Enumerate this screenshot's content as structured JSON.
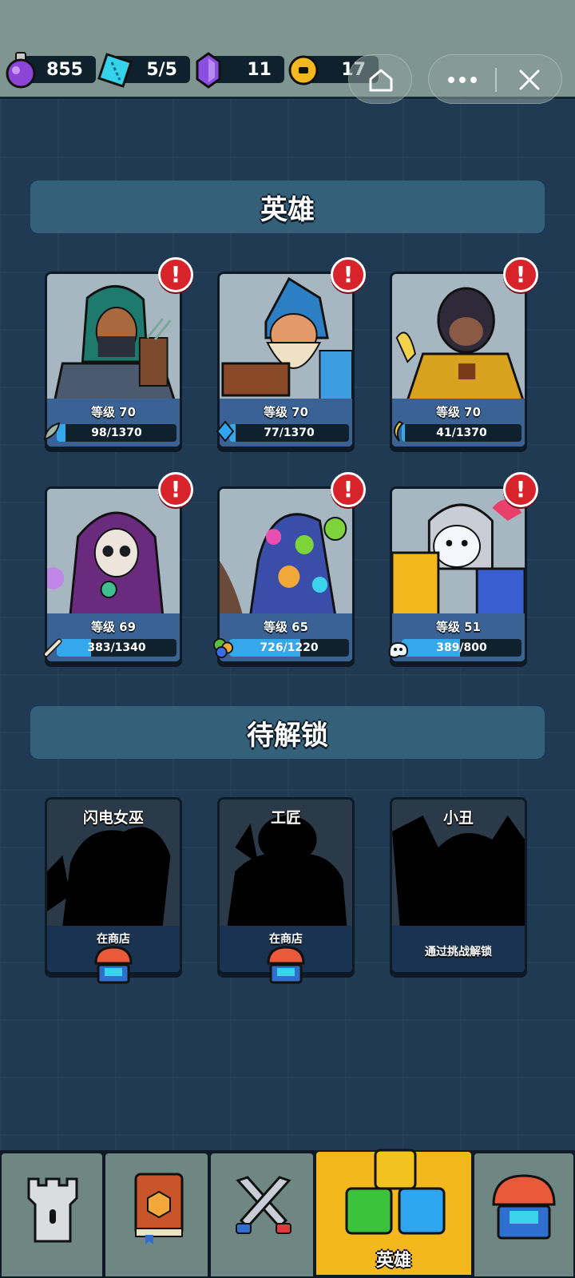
{
  "resources": [
    {
      "name": "potion",
      "value": "855",
      "icon": "potion-icon"
    },
    {
      "name": "ticket",
      "value": "5/5",
      "icon": "ticket-icon"
    },
    {
      "name": "gem",
      "value": "11",
      "icon": "gem-icon"
    },
    {
      "name": "coin",
      "value": "17",
      "icon": "coin-icon"
    }
  ],
  "sections": {
    "heroes_title": "英雄",
    "locked_title": "待解锁"
  },
  "heroes": [
    {
      "level": "等级 70",
      "progress": "98/1370",
      "fill": 0.0715,
      "shard_icon": "feather-shard-icon"
    },
    {
      "level": "等级 70",
      "progress": "77/1370",
      "fill": 0.0562,
      "shard_icon": "crystal-shard-icon"
    },
    {
      "level": "等级 70",
      "progress": "41/1370",
      "fill": 0.0299,
      "shard_icon": "banana-shard-icon"
    },
    {
      "level": "等级 69",
      "progress": "383/1340",
      "fill": 0.2858,
      "shard_icon": "bone-shard-icon"
    },
    {
      "level": "等级 65",
      "progress": "726/1220",
      "fill": 0.5951,
      "shard_icon": "slime-shard-icon"
    },
    {
      "level": "等级 51",
      "progress": "389/800",
      "fill": 0.4863,
      "shard_icon": "ghost-shard-icon"
    }
  ],
  "locked_heroes": [
    {
      "name": "闪电女巫",
      "unlock": "在商店"
    },
    {
      "name": "工匠",
      "unlock": "在商店"
    },
    {
      "name": "小丑",
      "unlock": "通过挑战解锁"
    }
  ],
  "nav": {
    "active_label": "英雄"
  },
  "alert_mark": "!",
  "colors": {
    "accent": "#f2b81e",
    "alert": "#d8232b",
    "progress": "#34a8ea",
    "banner": "#35607a"
  }
}
